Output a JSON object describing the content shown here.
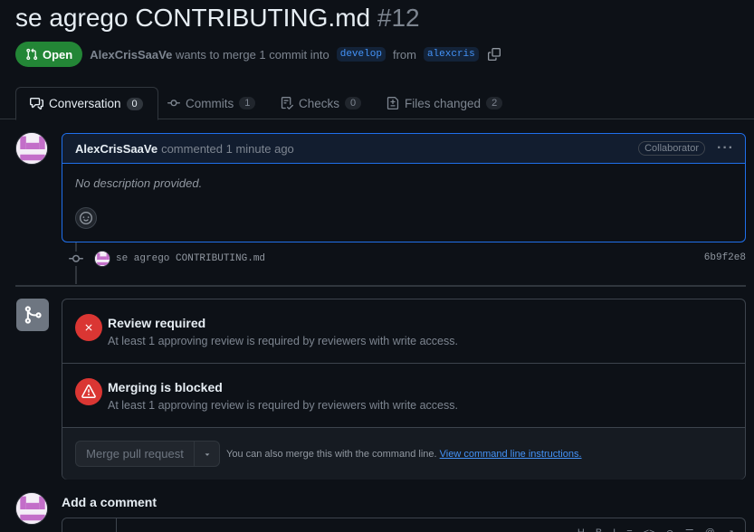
{
  "pr": {
    "title": "se agrego CONTRIBUTING.md",
    "number": "#12",
    "state": "Open",
    "author": "AlexCrisSaaVe",
    "summary_text": "wants to merge 1 commit into",
    "base_branch": "develop",
    "from_text": "from",
    "head_branch": "alexcris"
  },
  "tabs": [
    {
      "label": "Conversation",
      "count": "0",
      "icon": "comment-discussion-icon"
    },
    {
      "label": "Commits",
      "count": "1",
      "icon": "git-commit-icon"
    },
    {
      "label": "Checks",
      "count": "0",
      "icon": "checklist-icon"
    },
    {
      "label": "Files changed",
      "count": "2",
      "icon": "file-diff-icon"
    }
  ],
  "comment": {
    "author": "AlexCrisSaaVe",
    "meta": "commented 1 minute ago",
    "role": "Collaborator",
    "body": "No description provided."
  },
  "commit": {
    "message": "se agrego CONTRIBUTING.md",
    "sha": "6b9f2e8"
  },
  "merge": {
    "items": [
      {
        "title": "Review required",
        "desc": "At least 1 approving review is required by reviewers with write access.",
        "icon": "x-icon"
      },
      {
        "title": "Merging is blocked",
        "desc": "At least 1 approving review is required by reviewers with write access.",
        "icon": "alert-icon"
      }
    ],
    "button_label": "Merge pull request",
    "hint": "You can also merge this with the command line.",
    "hint_link": "View command line instructions."
  },
  "add_comment": {
    "title": "Add a comment"
  },
  "colors": {
    "background": "#0d1117",
    "open_green": "#238636",
    "link_blue": "#4493f8",
    "danger_red": "#da3633"
  }
}
